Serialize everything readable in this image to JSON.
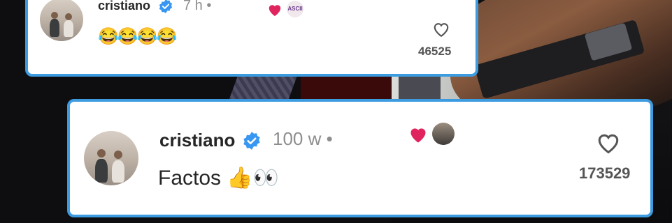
{
  "comments": [
    {
      "username": "cristiano",
      "time": "7 h •",
      "text": "😂😂😂😂",
      "reactor_label": "ASCII",
      "likes": "46525",
      "verified": true,
      "liked_by_author": true
    },
    {
      "username": "cristiano",
      "time": "100 w •",
      "text": "Factos 👍👀",
      "likes": "173529",
      "verified": true,
      "liked_by_author": true
    }
  ],
  "colors": {
    "card_border": "#3d9be0",
    "verified_badge": "#3897f0",
    "heart_red": "#e0245e",
    "username": "#262626",
    "timestamp": "#8e8e8e"
  },
  "icons": {
    "verified": "verified-badge-icon",
    "author_heart": "red-heart-icon",
    "like": "heart-outline-icon"
  }
}
